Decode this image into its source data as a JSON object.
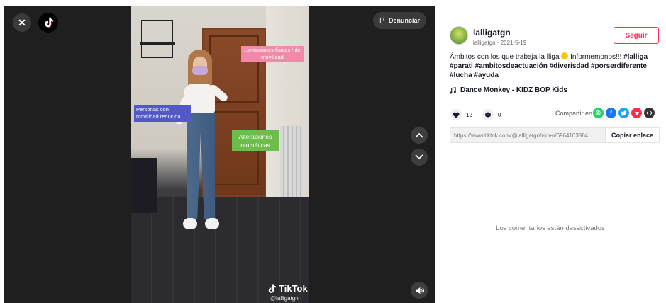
{
  "viewer": {
    "report_label": "Denunciar",
    "overlays": {
      "pink": "Limitaciones físicas / de movilidad",
      "blue": "Personas con movilidad reducida",
      "green": "Alteraciones reumáticas"
    },
    "watermark": {
      "brand": "TikTok",
      "user": "@lalligatgn"
    }
  },
  "post": {
    "username": "lalligatgn",
    "subline": "lalligatgn · 2021-5-19",
    "follow_label": "Seguir",
    "description_text": "Ámbitos con los que trabaja la lliga ",
    "description_text2": " Informemonos!!! ",
    "hashtags": [
      "#lalliga",
      "#parati",
      "#ambitosdeactuación",
      "#diverisdad",
      "#porserdiferente",
      "#lucha",
      "#ayuda"
    ],
    "music": "Dance Monkey - KIDZ BOP Kids",
    "likes": "12",
    "comments": "0",
    "share_label": "Compartir en",
    "link": "https://www.tiktok.com/@lalligatgn/video/6964103884...",
    "copy_label": "Copiar enlace",
    "comments_disabled": "Los comentarios están desactivados"
  },
  "colors": {
    "accent": "#fe2c55",
    "whatsapp": "#25d366",
    "facebook": "#1877f2",
    "twitter": "#1da1f2",
    "pinterest": "#fe2c55",
    "embed": "#333333"
  },
  "icons": [
    "close-icon",
    "tiktok-logo-icon",
    "flag-icon",
    "chevron-up-icon",
    "chevron-down-icon",
    "volume-icon",
    "music-note-icon",
    "heart-icon",
    "comment-icon",
    "whatsapp-icon",
    "facebook-icon",
    "twitter-icon",
    "pinterest-icon",
    "embed-icon"
  ]
}
